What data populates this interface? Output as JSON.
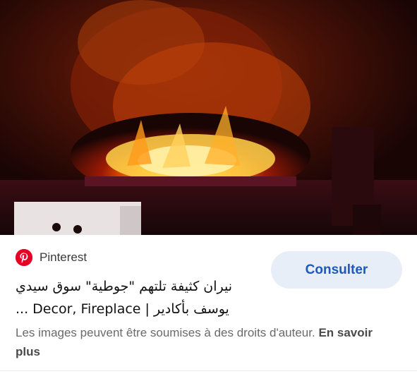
{
  "image": {
    "description_icon": "photo",
    "colors": {
      "sky": "#1a0606",
      "fire": "#ffb300",
      "flame": "#ff6a00",
      "glow": "#fff3a0"
    }
  },
  "source": {
    "icon": "pinterest-logo-icon",
    "name": "Pinterest",
    "brand_color": "#e60023"
  },
  "action": {
    "label": "Consulter",
    "bg_color": "#e8eef8",
    "text_color": "#1d59b8"
  },
  "title": {
    "line1": "نيران كثيفة تلتهم \"جوطية\" سوق سيدي",
    "line2": "يوسف بأكادير | Decor, Fireplace ..."
  },
  "notice": {
    "text": "Les images peuvent être soumises à des droits d'auteur.",
    "link": "En savoir plus"
  }
}
